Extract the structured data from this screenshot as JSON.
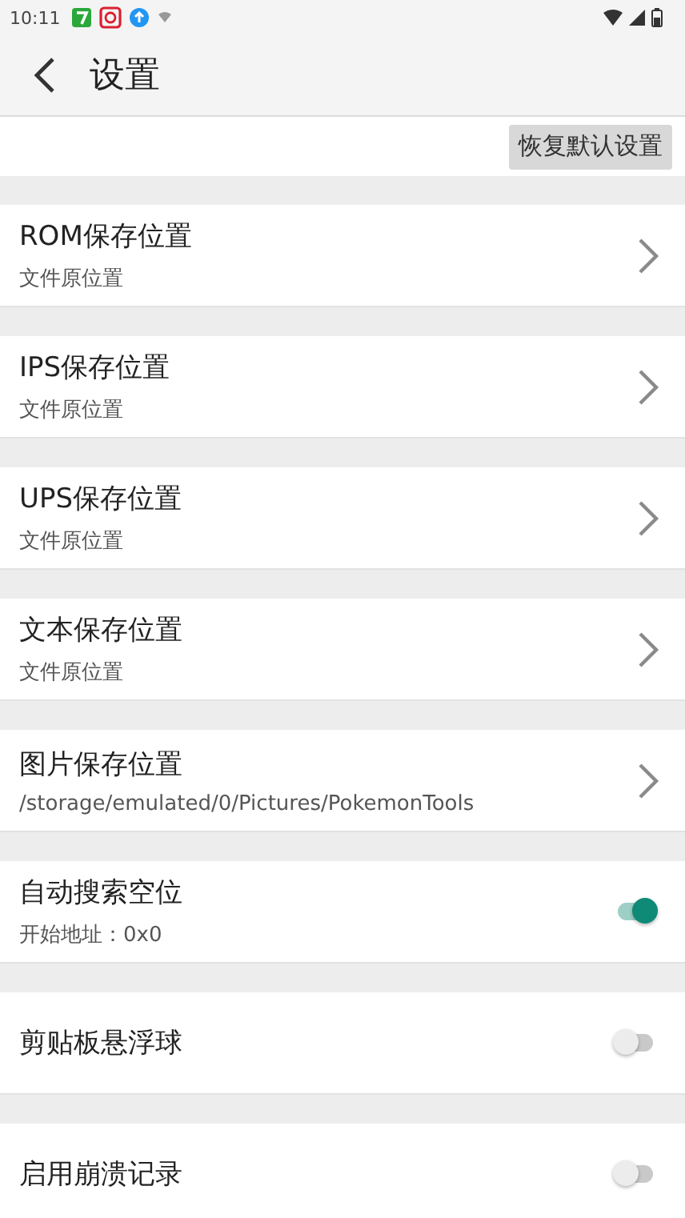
{
  "status_bar": {
    "time": "10:11"
  },
  "toolbar": {
    "title": "设置"
  },
  "reset_button": {
    "label": "恢复默认设置"
  },
  "settings": [
    {
      "kind": "link",
      "title": "ROM保存位置",
      "subtitle": "文件原位置"
    },
    {
      "kind": "link",
      "title": "IPS保存位置",
      "subtitle": "文件原位置"
    },
    {
      "kind": "link",
      "title": "UPS保存位置",
      "subtitle": "文件原位置"
    },
    {
      "kind": "link",
      "title": "文本保存位置",
      "subtitle": "文件原位置"
    },
    {
      "kind": "link",
      "title": "图片保存位置",
      "subtitle": "/storage/emulated/0/Pictures/PokemonTools"
    },
    {
      "kind": "switch",
      "title": "自动搜索空位",
      "subtitle": "开始地址：0x0",
      "on": true
    },
    {
      "kind": "switch",
      "title": "剪贴板悬浮球",
      "on": false
    },
    {
      "kind": "switch",
      "title": "启用崩溃记录",
      "on": false
    }
  ]
}
